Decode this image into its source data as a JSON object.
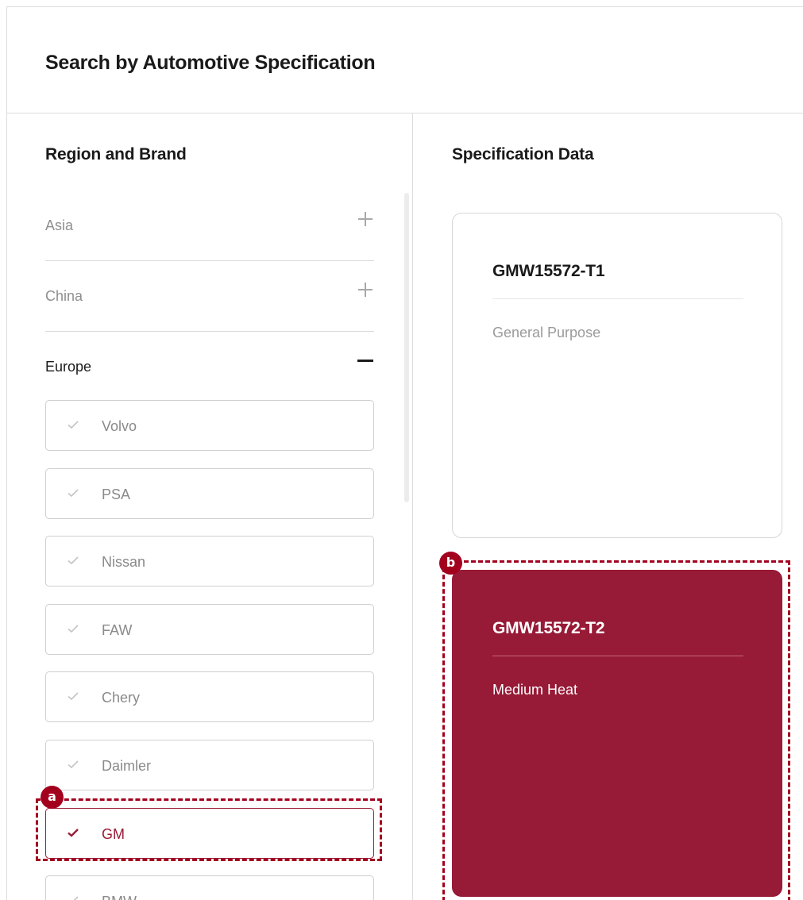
{
  "page": {
    "title": "Search by Automotive Specification"
  },
  "left_panel": {
    "title": "Region and Brand",
    "regions": [
      {
        "label": "Asia",
        "toggle_icon": "plus-icon"
      },
      {
        "label": "China",
        "toggle_icon": "plus-icon"
      },
      {
        "label": "Europe",
        "toggle_icon": "minus-icon"
      }
    ],
    "brands": [
      {
        "label": "Volvo",
        "selected": false
      },
      {
        "label": "PSA",
        "selected": false
      },
      {
        "label": "Nissan",
        "selected": false
      },
      {
        "label": "FAW",
        "selected": false
      },
      {
        "label": "Chery",
        "selected": false
      },
      {
        "label": "Daimler",
        "selected": false
      },
      {
        "label": "GM",
        "selected": true
      },
      {
        "label": "BMW",
        "selected": false
      }
    ]
  },
  "right_panel": {
    "title": "Specification Data",
    "cards": [
      {
        "title": "GMW15572-T1",
        "description": "General Purpose",
        "active": false
      },
      {
        "title": "GMW15572-T2",
        "description": "Medium Heat",
        "active": true
      }
    ]
  },
  "annotations": [
    {
      "label": "a"
    },
    {
      "label": "b"
    }
  ],
  "colors": {
    "accent": "#971a36",
    "callout": "#a3001e",
    "check_inactive": "#c4c4c4"
  }
}
